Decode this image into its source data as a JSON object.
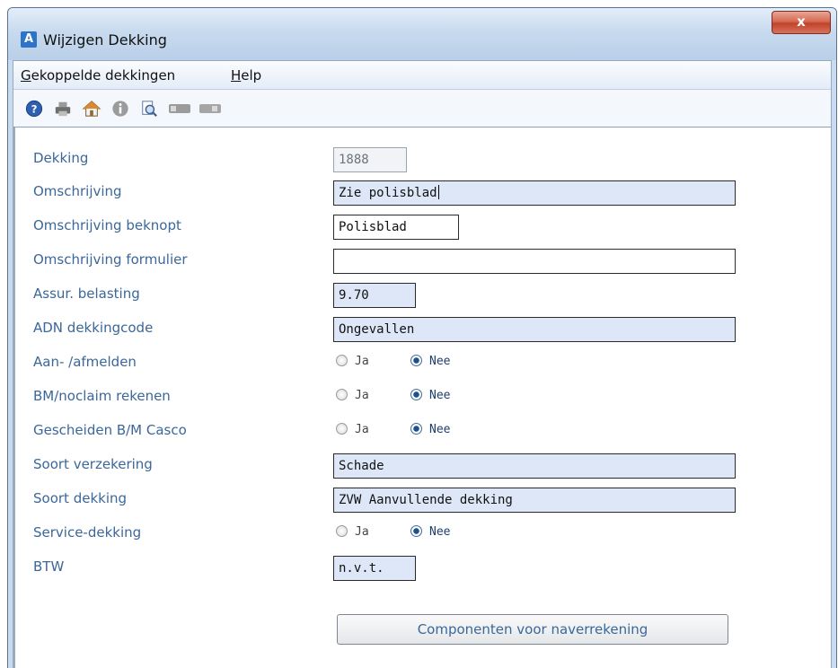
{
  "window": {
    "title": "Wijzigen Dekking",
    "app_icon_letter": "A",
    "close_glyph": "x"
  },
  "menu": {
    "items": [
      {
        "mnemonic": "G",
        "rest": "ekoppelde dekkingen"
      },
      {
        "mnemonic": "H",
        "rest": "elp"
      }
    ]
  },
  "toolbar": {
    "icons": [
      "help-icon",
      "print-icon",
      "home-icon",
      "info-icon",
      "search-document-icon",
      "toggle-icon",
      "toggle-icon"
    ]
  },
  "form": {
    "dekking": {
      "label": "Dekking",
      "value": "1888"
    },
    "omschrijving": {
      "label": "Omschrijving",
      "value": "Zie polisblad"
    },
    "omschrijving_beknopt": {
      "label": "Omschrijving beknopt",
      "value": "Polisblad"
    },
    "omschrijving_formulier": {
      "label": "Omschrijving formulier",
      "value": ""
    },
    "assur_belasting": {
      "label": "Assur. belasting",
      "value": "9.70"
    },
    "adn_dekkingcode": {
      "label": "ADN dekkingcode",
      "value": "Ongevallen"
    },
    "aan_afmelden": {
      "label": "Aan- /afmelden",
      "options": [
        "Ja",
        "Nee"
      ],
      "selected": "Nee"
    },
    "bm_noclaim": {
      "label": "BM/noclaim rekenen",
      "options": [
        "Ja",
        "Nee"
      ],
      "selected": "Nee"
    },
    "gescheiden_bm": {
      "label": "Gescheiden B/M Casco",
      "options": [
        "Ja",
        "Nee"
      ],
      "selected": "Nee"
    },
    "soort_verzekering": {
      "label": "Soort verzekering",
      "value": "Schade"
    },
    "soort_dekking": {
      "label": "Soort dekking",
      "value": "ZVW Aanvullende dekking"
    },
    "service_dekking": {
      "label": "Service-dekking",
      "options": [
        "Ja",
        "Nee"
      ],
      "selected": "Nee"
    },
    "btw": {
      "label": "BTW",
      "value": "n.v.t."
    }
  },
  "buttons": {
    "componenten": "Componenten voor naverrekening"
  }
}
